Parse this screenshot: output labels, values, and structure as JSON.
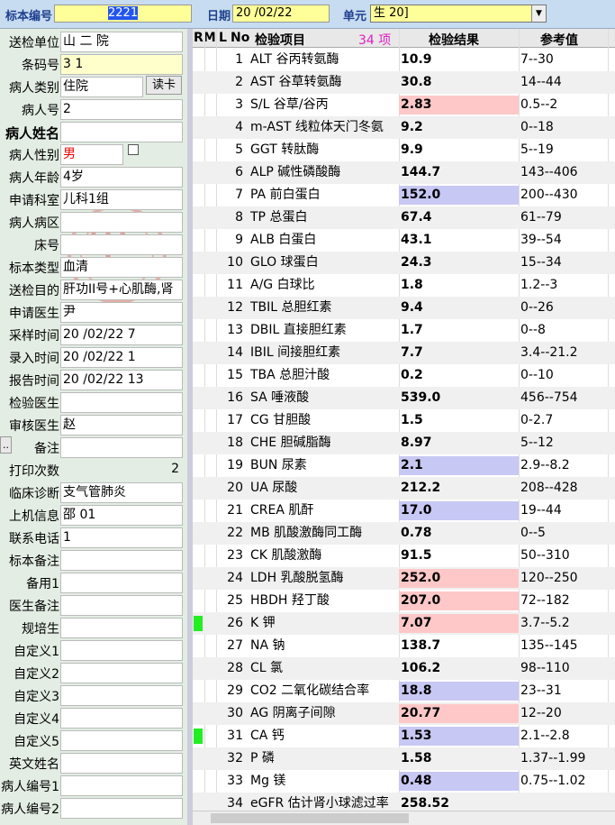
{
  "topbar": {
    "specimen_label": "标本编号",
    "specimen_value": "2221",
    "date_label": "日期",
    "date_value": "20  /02/22",
    "unit_label": "单元",
    "unit_value": "生  20]"
  },
  "form": {
    "fields": [
      {
        "label": "送检单位",
        "value": "山   二    院"
      },
      {
        "label": "条码号",
        "value": "3              1"
      },
      {
        "label": "病人类别",
        "value": "住院"
      },
      {
        "label": "病人号",
        "value": "2"
      },
      {
        "label": "病人姓名",
        "value": ""
      },
      {
        "label": "病人性别",
        "value": "男"
      },
      {
        "label": "病人年龄",
        "value": "4岁"
      },
      {
        "label": "申请科室",
        "value": "儿科1组"
      },
      {
        "label": "病人病区",
        "value": ""
      },
      {
        "label": "床号",
        "value": ""
      },
      {
        "label": "标本类型",
        "value": "血清"
      },
      {
        "label": "送检目的",
        "value": "肝功II号+心肌酶,肾"
      },
      {
        "label": "申请医生",
        "value": "尹"
      },
      {
        "label": "采样时间",
        "value": "20  /02/22   7"
      },
      {
        "label": "录入时间",
        "value": "20  /02/22 1"
      },
      {
        "label": "报告时间",
        "value": "20  /02/22 13"
      },
      {
        "label": "检验医生",
        "value": ""
      },
      {
        "label": "审核医生",
        "value": "赵"
      },
      {
        "label": "备注",
        "value": ""
      },
      {
        "label": "打印次数",
        "value": "2"
      },
      {
        "label": "临床诊断",
        "value": "支气管肺炎"
      },
      {
        "label": "上机信息",
        "value": "邵        01"
      },
      {
        "label": "联系电话",
        "value": "1"
      },
      {
        "label": "标本备注",
        "value": ""
      },
      {
        "label": "备用1",
        "value": ""
      },
      {
        "label": "医生备注",
        "value": ""
      },
      {
        "label": "规培生",
        "value": ""
      },
      {
        "label": "自定义1",
        "value": ""
      },
      {
        "label": "自定义2",
        "value": ""
      },
      {
        "label": "自定义3",
        "value": ""
      },
      {
        "label": "自定义4",
        "value": ""
      },
      {
        "label": "自定义5",
        "value": ""
      },
      {
        "label": "英文姓名",
        "value": ""
      },
      {
        "label": "病人编号1",
        "value": ""
      },
      {
        "label": "病人编号2",
        "value": ""
      }
    ],
    "read_card_label": "读卡",
    "dots_label": "..",
    "stamp_char": "甲"
  },
  "grid": {
    "col_rm": "RM",
    "col_l": "L",
    "col_no": "No",
    "col_item": "检验项目",
    "item_count": "34 项",
    "col_result": "检验结果",
    "col_ref": "参考值",
    "rows": [
      {
        "no": "1",
        "name": "ALT 谷丙转氨酶",
        "result": "10.9",
        "ref": "7--30",
        "flag": ""
      },
      {
        "no": "2",
        "name": "AST 谷草转氨酶",
        "result": "30.8",
        "ref": "14--44",
        "flag": ""
      },
      {
        "no": "3",
        "name": "S/L 谷草/谷丙",
        "result": "2.83",
        "ref": "0.5--2",
        "flag": "H"
      },
      {
        "no": "4",
        "name": "m-AST 线粒体天门冬氨",
        "result": "9.2",
        "ref": "0--18",
        "flag": ""
      },
      {
        "no": "5",
        "name": "GGT 转肽酶",
        "result": "9.9",
        "ref": "5--19",
        "flag": ""
      },
      {
        "no": "6",
        "name": "ALP 碱性磷酸酶",
        "result": "144.7",
        "ref": "143--406",
        "flag": ""
      },
      {
        "no": "7",
        "name": "PA 前白蛋白",
        "result": "152.0",
        "ref": "200--430",
        "flag": "L"
      },
      {
        "no": "8",
        "name": "TP 总蛋白",
        "result": "67.4",
        "ref": "61--79",
        "flag": ""
      },
      {
        "no": "9",
        "name": "ALB 白蛋白",
        "result": "43.1",
        "ref": "39--54",
        "flag": ""
      },
      {
        "no": "10",
        "name": "GLO 球蛋白",
        "result": "24.3",
        "ref": "15--34",
        "flag": ""
      },
      {
        "no": "11",
        "name": "A/G 白球比",
        "result": "1.8",
        "ref": "1.2--3",
        "flag": ""
      },
      {
        "no": "12",
        "name": "TBIL 总胆红素",
        "result": "9.4",
        "ref": "0--26",
        "flag": ""
      },
      {
        "no": "13",
        "name": "DBIL 直接胆红素",
        "result": "1.7",
        "ref": "0--8",
        "flag": ""
      },
      {
        "no": "14",
        "name": "IBIL 间接胆红素",
        "result": "7.7",
        "ref": "3.4--21.2",
        "flag": ""
      },
      {
        "no": "15",
        "name": "TBA 总胆汁酸",
        "result": "0.2",
        "ref": "0--10",
        "flag": ""
      },
      {
        "no": "16",
        "name": "SA 唾液酸",
        "result": "539.0",
        "ref": "456--754",
        "flag": ""
      },
      {
        "no": "17",
        "name": "CG 甘胆酸",
        "result": "1.5",
        "ref": "0-2.7",
        "flag": ""
      },
      {
        "no": "18",
        "name": "CHE 胆碱脂酶",
        "result": "8.97",
        "ref": "5--12",
        "flag": ""
      },
      {
        "no": "19",
        "name": "BUN 尿素",
        "result": "2.1",
        "ref": "2.9--8.2",
        "flag": "L"
      },
      {
        "no": "20",
        "name": "UA 尿酸",
        "result": "212.2",
        "ref": "208--428",
        "flag": ""
      },
      {
        "no": "21",
        "name": "CREA 肌酐",
        "result": "17.0",
        "ref": "19--44",
        "flag": "L"
      },
      {
        "no": "22",
        "name": "MB 肌酸激酶同工酶",
        "result": "0.78",
        "ref": "0--5",
        "flag": ""
      },
      {
        "no": "23",
        "name": "CK 肌酸激酶",
        "result": "91.5",
        "ref": "50--310",
        "flag": ""
      },
      {
        "no": "24",
        "name": "LDH 乳酸脱氢酶",
        "result": "252.0",
        "ref": "120--250",
        "flag": "H"
      },
      {
        "no": "25",
        "name": "HBDH 羟丁酸",
        "result": "207.0",
        "ref": "72--182",
        "flag": "H"
      },
      {
        "no": "26",
        "name": "K 钾",
        "result": "7.07",
        "ref": "3.7--5.2",
        "flag": "H",
        "rm": true
      },
      {
        "no": "27",
        "name": "NA 钠",
        "result": "138.7",
        "ref": "135--145",
        "flag": ""
      },
      {
        "no": "28",
        "name": "CL 氯",
        "result": "106.2",
        "ref": "98--110",
        "flag": ""
      },
      {
        "no": "29",
        "name": "CO2 二氧化碳结合率",
        "result": "18.8",
        "ref": "23--31",
        "flag": "L"
      },
      {
        "no": "30",
        "name": "AG 阴离子间隙",
        "result": "20.77",
        "ref": "12--20",
        "flag": "H"
      },
      {
        "no": "31",
        "name": "CA 钙",
        "result": "1.53",
        "ref": "2.1--2.8",
        "flag": "L",
        "rm": true
      },
      {
        "no": "32",
        "name": "P 磷",
        "result": "1.58",
        "ref": "1.37--1.99",
        "flag": ""
      },
      {
        "no": "33",
        "name": "Mg 镁",
        "result": "0.48",
        "ref": "0.75--1.02",
        "flag": "L"
      },
      {
        "no": "34",
        "name": "eGFR 估计肾小球滤过率",
        "result": "258.52",
        "ref": "",
        "flag": ""
      }
    ]
  },
  "colors": {
    "high": "#ffc8c8",
    "low": "#c8c8f4",
    "flag": "#22ee22"
  }
}
